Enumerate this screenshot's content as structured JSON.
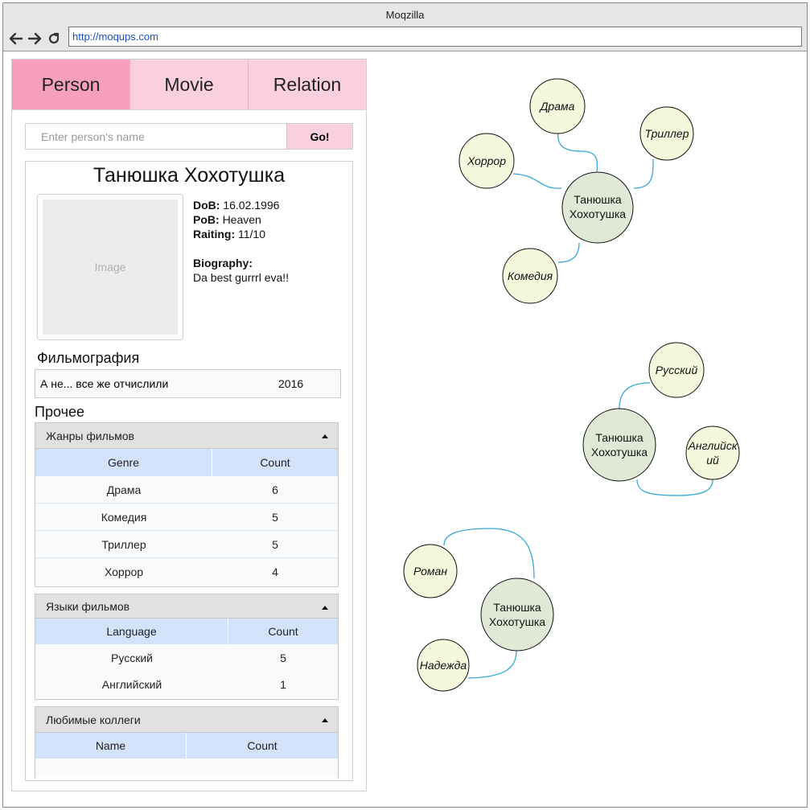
{
  "window": {
    "title": "Moqzilla",
    "url": "http://moqups.com"
  },
  "tabs": [
    "Person",
    "Movie",
    "Relation"
  ],
  "search": {
    "placeholder": "Enter person's name",
    "button": "Go!"
  },
  "person": {
    "name": "Танюшка Хохотушка",
    "image_placeholder": "Image",
    "dob_label": "DoB:",
    "dob": "16.02.1996",
    "pob_label": "PoB:",
    "pob": "Heaven",
    "rating_label": "Raiting:",
    "rating": "11/10",
    "bio_label": "Biography:",
    "bio": "Da best gurrrl eva!!"
  },
  "filmography": {
    "title": "Фильмография",
    "rows": [
      {
        "title": "А не... все же отчислили",
        "year": "2016"
      }
    ]
  },
  "other": {
    "title": "Прочее",
    "genres": {
      "title": "Жанры фильмов",
      "headers": [
        "Genre",
        "Count"
      ],
      "rows": [
        [
          "Драма",
          "6"
        ],
        [
          "Комедия",
          "5"
        ],
        [
          "Триллер",
          "5"
        ],
        [
          "Хоррор",
          "4"
        ]
      ]
    },
    "languages": {
      "title": "Языки фильмов",
      "headers": [
        "Language",
        "Count"
      ],
      "rows": [
        [
          "Русский",
          "5"
        ],
        [
          "Английский",
          "1"
        ]
      ]
    },
    "colleagues": {
      "title": "Любимые коллеги",
      "headers": [
        "Name",
        "Count"
      ],
      "rows": []
    }
  },
  "graphs": {
    "center_line1": "Танюшка",
    "center_line2": "Хохотушка",
    "genres": [
      "Драма",
      "Триллер",
      "Хоррор",
      "Комедия"
    ],
    "languages": {
      "ru": "Русский",
      "en_line1": "Английск",
      "en_line2": "ий"
    },
    "colleagues": [
      "Роман",
      "Надежда"
    ]
  },
  "colors": {
    "tab_active": "#f7a0bd",
    "tab": "#f9d0dc",
    "center_node": "#dfe9d5",
    "leaf_node": "#f6f8dd",
    "edge": "#35a7d8"
  }
}
